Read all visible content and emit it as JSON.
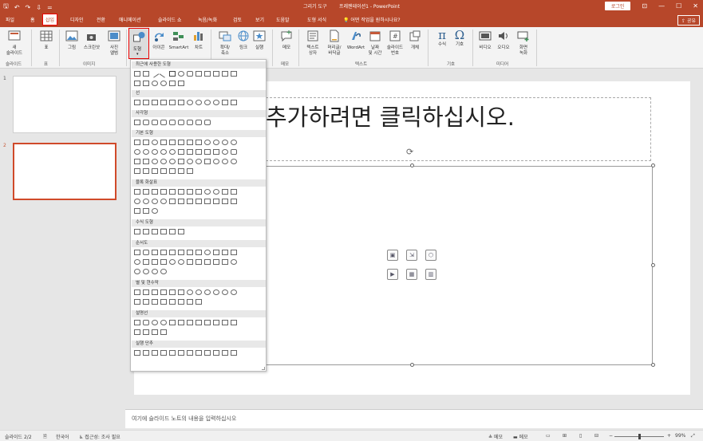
{
  "titlebar": {
    "qat": [
      "🖫",
      "↶",
      "↷",
      "⇩",
      "="
    ],
    "context": "그리기 도구",
    "title": "프레젠테이션1 - PowerPoint",
    "login": "로그인",
    "window_btns": [
      "⊡",
      "—",
      "☐",
      "✕"
    ]
  },
  "tabs": [
    "파일",
    "홈",
    "삽입",
    "디자인",
    "전환",
    "애니메이션",
    "슬라이드 쇼",
    "녹음/녹화",
    "검토",
    "보기",
    "도움말",
    "도형 서식"
  ],
  "active_tab": "삽입",
  "tell_me": "어떤 작업을 원하시나요?",
  "share": "공유",
  "ribbon": {
    "buttons": {
      "new_slide": "새\n슬라이드",
      "table": "표",
      "pictures": "그림",
      "screenshot": "스크린샷",
      "photo_album": "사진\n앨범",
      "shapes": "도형",
      "icons": "아이콘",
      "smartart": "SmartArt",
      "chart": "차트",
      "zoom": "확대/\n축소",
      "link": "링크",
      "action": "실행",
      "comment": "메모",
      "textbox": "텍스트\n상자",
      "header_footer": "머리글/\n바닥글",
      "wordart": "WordArt",
      "date_time": "날짜\n및 시간",
      "slide_number": "슬라이드\n번호",
      "object": "개체",
      "equation": "수식",
      "symbol": "기호",
      "video": "비디오",
      "audio": "오디오",
      "screen_recording": "화면\n녹화"
    },
    "groups": {
      "slides": "슬라이드",
      "tables": "표",
      "images": "이미지",
      "comments": "메모",
      "text": "텍스트",
      "symbols": "기호",
      "media": "미디어"
    }
  },
  "dropdown": {
    "categories": [
      "최근에 사용한 도형",
      "선",
      "사각형",
      "기본 도형",
      "블록 화살표",
      "수식 도형",
      "순서도",
      "별 및 현수막",
      "설명선",
      "실행 단추"
    ]
  },
  "slides": {
    "numbers": [
      "1",
      "2"
    ]
  },
  "slide": {
    "title_placeholder": "추가하려면 클릭하십시오."
  },
  "notes": "여기에 슬라이드 노트의 내용을 입력하십시오",
  "status": {
    "slide_count": "슬라이드 2/2",
    "language": "한국어",
    "accessibility": "접근성: 조사 필요",
    "notes_btn": "메모",
    "comments_btn": "메모",
    "zoom": "99%"
  }
}
